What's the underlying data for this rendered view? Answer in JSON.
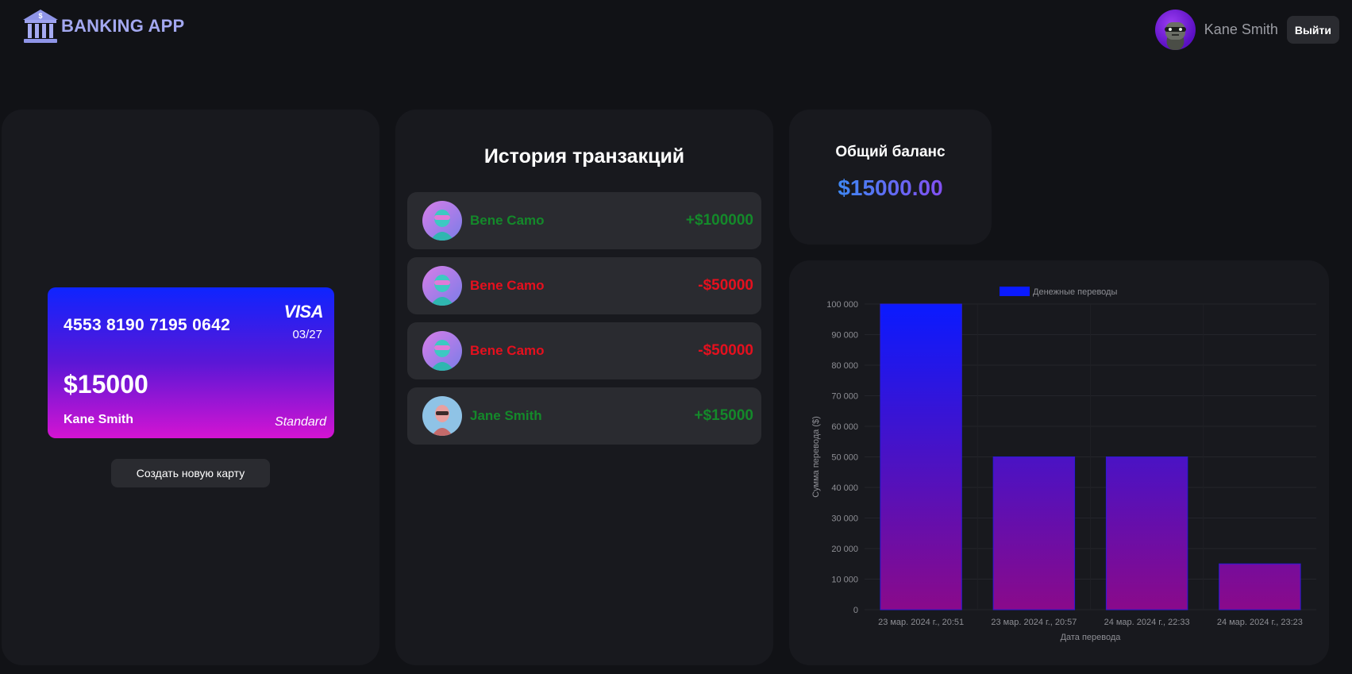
{
  "header": {
    "logo_text": "BANKING APP",
    "user_name": "Kane Smith",
    "logout_label": "Выйти"
  },
  "card": {
    "number": "4553 8190 7195 0642",
    "brand": "VISA",
    "expiry": "03/27",
    "balance": "$15000",
    "holder": "Kane Smith",
    "tier": "Standard",
    "create_button_label": "Создать новую карту"
  },
  "transactions": {
    "title": "История транзакций",
    "items": [
      {
        "name": "Bene Camo",
        "amount": "+$100000",
        "type": "income"
      },
      {
        "name": "Bene Camo",
        "amount": "-$50000",
        "type": "expense"
      },
      {
        "name": "Bene Camo",
        "amount": "-$50000",
        "type": "expense"
      },
      {
        "name": "Jane Smith",
        "amount": "+$15000",
        "type": "income"
      }
    ]
  },
  "balance": {
    "title": "Общий баланс",
    "value": "$15000.00"
  },
  "colors": {
    "income": "#14892a",
    "expense": "#e5101e",
    "accent_blue": "#0a1aff",
    "accent_magenta": "#8a0a8a"
  },
  "chart_data": {
    "type": "bar",
    "legend": "Денежные переводы",
    "legend_placement": "top",
    "categories": [
      "23 мар. 2024 г., 20:51",
      "23 мар. 2024 г., 20:57",
      "24 мар. 2024 г., 22:33",
      "24 мар. 2024 г., 23:23"
    ],
    "series": [
      {
        "name": "Денежные переводы",
        "values": [
          100000,
          50000,
          50000,
          15000
        ]
      }
    ],
    "xlabel": "Дата перевода",
    "ylabel": "Сумма перевода ($)",
    "ylim": [
      0,
      100000
    ],
    "yticks": [
      "0",
      "10 000",
      "20 000",
      "30 000",
      "40 000",
      "50 000",
      "60 000",
      "70 000",
      "80 000",
      "90 000",
      "100 000"
    ],
    "grid": true
  }
}
